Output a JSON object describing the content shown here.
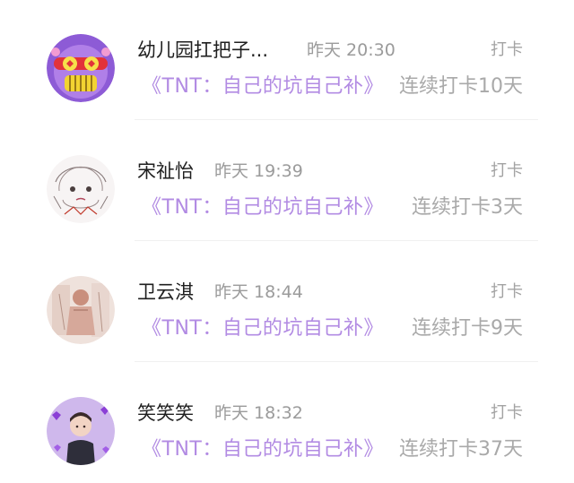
{
  "items": [
    {
      "avatar_icon": "cartoon-avatar-icon",
      "name": "幼儿园扛把子...",
      "time": "昨天 20:30",
      "checkin_label": "打卡",
      "book": "《TNT：自己的坑自己补》",
      "streak": "连续打卡10天"
    },
    {
      "avatar_icon": "sketch-avatar-icon",
      "name": "宋祉怡",
      "time": "昨天 19:39",
      "checkin_label": "打卡",
      "book": "《TNT：自己的坑自己补》",
      "streak": "连续打卡3天"
    },
    {
      "avatar_icon": "illustration-avatar-icon",
      "name": "卫云淇",
      "time": "昨天 18:44",
      "checkin_label": "打卡",
      "book": "《TNT：自己的坑自己补》",
      "streak": "连续打卡9天"
    },
    {
      "avatar_icon": "photo-avatar-icon",
      "name": "笑笑笑",
      "time": "昨天 18:32",
      "checkin_label": "打卡",
      "book": "《TNT：自己的坑自己补》",
      "streak": "连续打卡37天"
    }
  ],
  "colors": {
    "book_title": "#b28be3",
    "muted": "#a9a9a9",
    "name": "#1f1f1f"
  }
}
